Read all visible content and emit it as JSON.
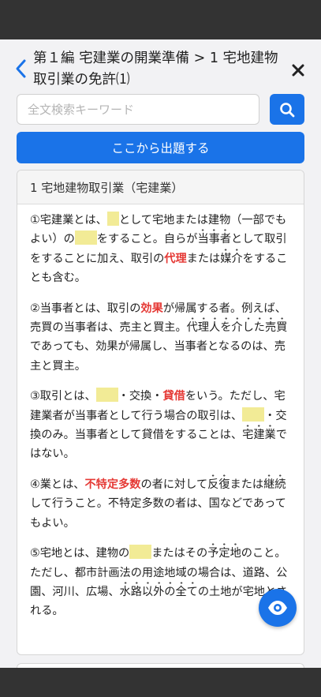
{
  "header": {
    "title": "第１編 宅建業の開業準備 > 1 宅地建物取引業の免許⑴"
  },
  "search": {
    "placeholder": "全文検索キーワード"
  },
  "start_button_label": "ここから出題する",
  "card": {
    "heading": "1 宅地建物取引業（宅建業）",
    "p1": {
      "a": "①宅建業とは、",
      "b": "として宅地または建物（一部でもよい）の",
      "c": "をすること。自らが",
      "d": "当事者",
      "e": "として取引をすることに加え、取引の",
      "f": "代理",
      "g": "または",
      "h": "媒介",
      "i": "をすることも含む。"
    },
    "p2": {
      "a": "②当事者とは、取引の",
      "b": "効果",
      "c": "が帰属する者。例えば、売買の当事者は、売主と買主。",
      "d": "代理人を介した売買",
      "e": "であっても、効果が帰属し、当事者となるのは、売主と買主。"
    },
    "p3": {
      "a": "③取引とは、",
      "b": "・交換・",
      "c": "貸借",
      "d": "をいう。ただし、",
      "e": "宅建業者",
      "f": "が当事者として行う場合の取引は、",
      "g": "・",
      "h": "交換のみ",
      "i": "。当事者として貸借をすることは、",
      "j": "宅建業",
      "k": "ではない。"
    },
    "p4": {
      "a": "④業とは、",
      "b": "不特定多数",
      "c": "の者に対して",
      "d": "反復",
      "e": "または",
      "f": "継続",
      "g": "して行うこと。不特定多数の者は、国などであってもよい。"
    },
    "p5": {
      "a": "⑤宅地とは、建物の",
      "b": "またはその",
      "c": "予定地",
      "d": "のこと。ただし、都市計画法の用途地域の場合は、道路、",
      "e": "公園",
      "f": "、河川、広場、",
      "g": "水路以外の全て",
      "h": "の土地が宅地とされる。"
    }
  },
  "colors": {
    "accent": "#1a73e8",
    "highlight_blank": "#f2eb96",
    "emphasis_red": "#e53935",
    "status_bar": "#333333"
  },
  "icons": {
    "back": "chevron-left-icon",
    "close": "close-icon",
    "search": "search-icon",
    "toggle": "eye-icon"
  }
}
